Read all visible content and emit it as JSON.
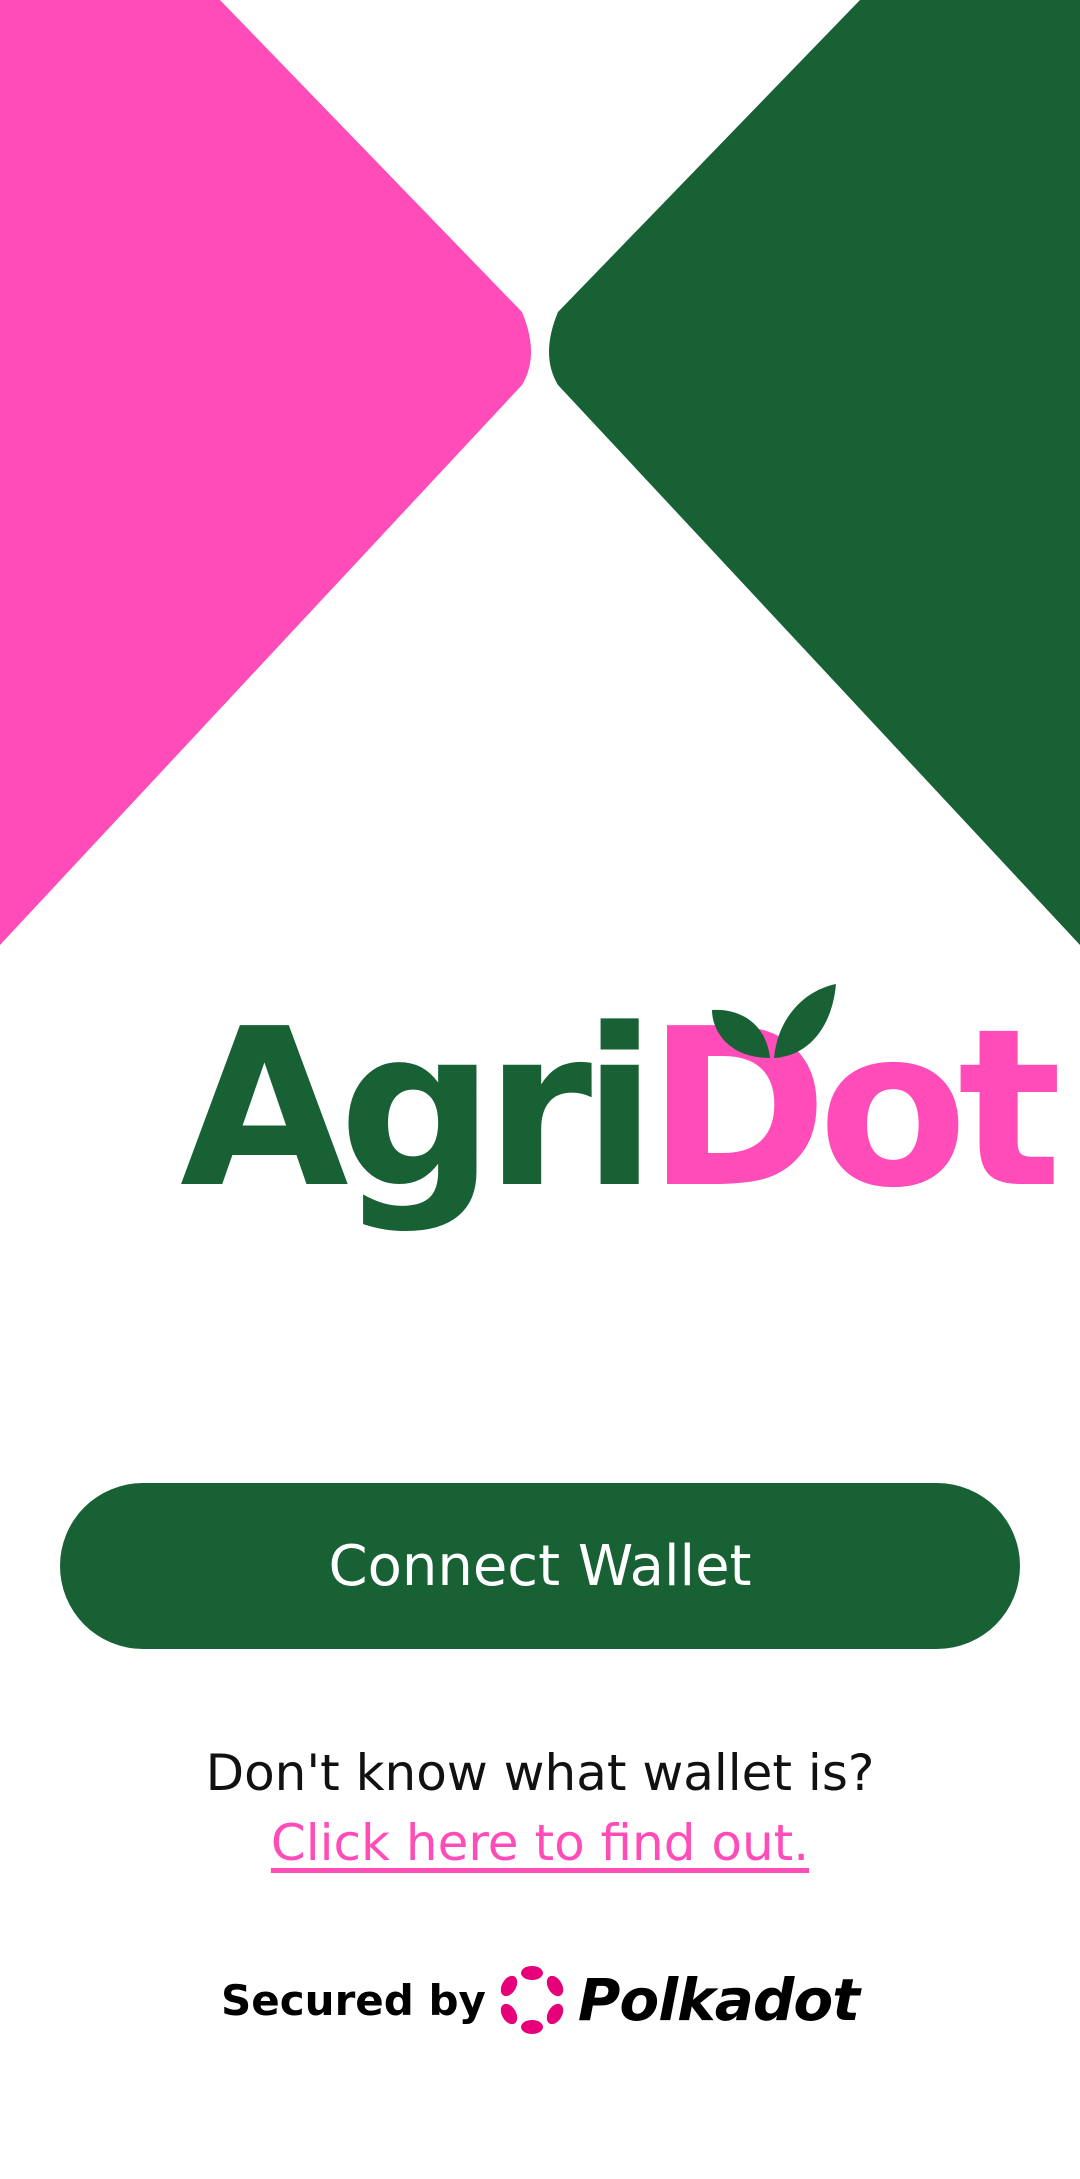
{
  "app": {
    "brand_part1": "Agri",
    "brand_part2": "Dot"
  },
  "colors": {
    "primary_green": "#186134",
    "accent_pink": "#ff4cb9",
    "polkadot_pink": "#e6007a"
  },
  "actions": {
    "connect_label": "Connect Wallet"
  },
  "help": {
    "question": "Don't know what wallet is?",
    "link_label": "Click here to find out."
  },
  "footer": {
    "secured_label": "Secured by",
    "provider_name": "Polkadot",
    "provider_icon": "polkadot-logo-icon"
  }
}
